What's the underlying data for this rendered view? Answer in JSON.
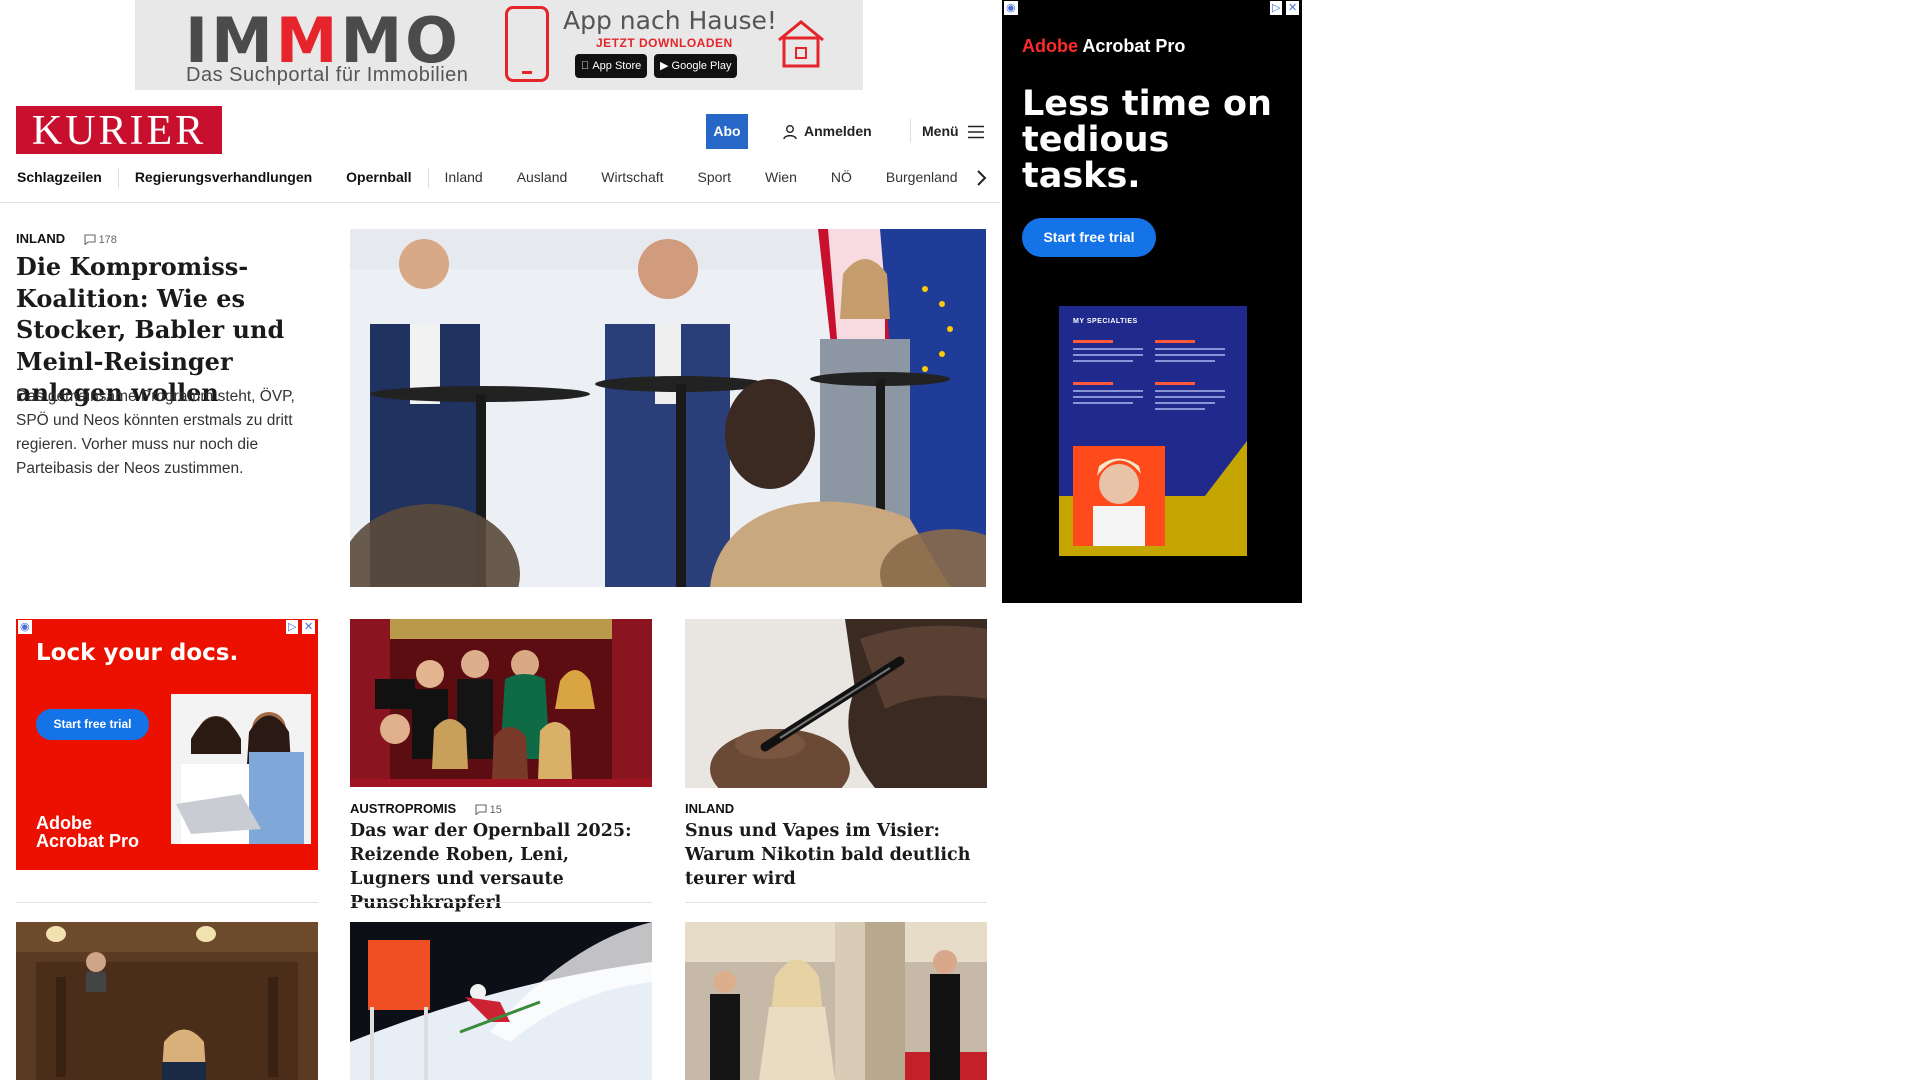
{
  "top_ad": {
    "logo_prefix": "IM",
    "logo_red": "M",
    "logo_suffix": "MO",
    "tagline": "Das Suchportal für Immobilien",
    "title": "App nach Hause!",
    "subtitle": "JETZT DOWNLOADEN",
    "app_store": "App Store",
    "google_play": "Google Play"
  },
  "header": {
    "logo": "KURIER",
    "abo": "Abo",
    "login": "Anmelden",
    "menu": "Menü"
  },
  "nav": {
    "items": [
      "Schlagzeilen",
      "Regierungsverhandlungen",
      "Opernball",
      "Inland",
      "Ausland",
      "Wirtschaft",
      "Sport",
      "Wien",
      "NÖ",
      "Burgenland"
    ]
  },
  "lead": {
    "kicker": "INLAND",
    "comments": "178",
    "title": "Die Kompromiss-Koalition: Wie es Stocker, Babler und Meinl-Reisinger anlegen wollen",
    "teaser": "Das gemeinsame Programm steht, ÖVP, SPÖ und Neos könnten erstmals zu dritt regieren. Vorher muss nur noch die Parteibasis der Neos zustimmen."
  },
  "side_ad": {
    "brand_red": "Adobe",
    "brand_white": "Acrobat Pro",
    "headline": "Less time on tedious tasks.",
    "button": "Start free trial",
    "card_title": "MY SPECIALTIES"
  },
  "small_ad": {
    "headline": "Lock your docs.",
    "button": "Start free trial",
    "brand": "Adobe Acrobat Pro"
  },
  "cards": [
    {
      "kicker": "AUSTROPROMIS",
      "comments": "15",
      "title": "Das war der Opernball 2025: Reizende Roben, Leni, Lugners und versaute Punschkrapferl"
    },
    {
      "kicker": "INLAND",
      "title": "Snus und Vapes im Visier: Warum Nikotin bald deutlich teurer wird"
    }
  ],
  "colors": {
    "brand_red": "#c8102e",
    "abo_blue": "#2767c7",
    "adobe_red": "#eb1000",
    "adobe_blue": "#1473e6"
  }
}
